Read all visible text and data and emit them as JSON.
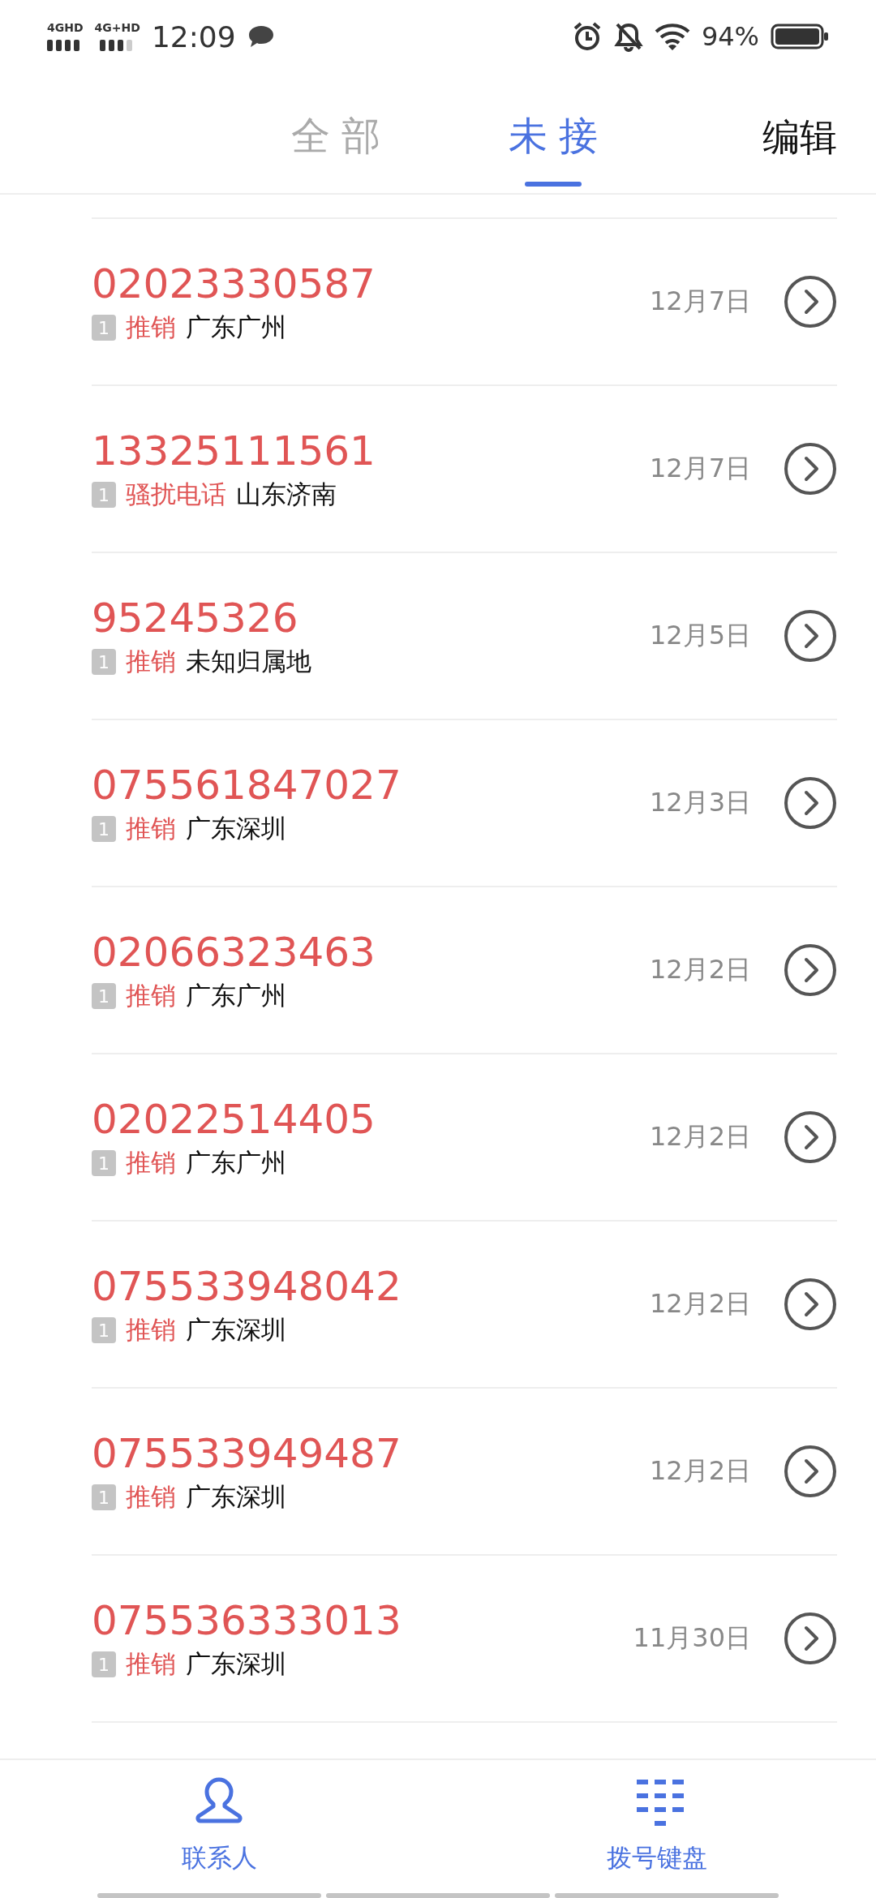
{
  "status_bar": {
    "network_1": "4GHD",
    "network_2": "4G+HD",
    "time": "12:09",
    "battery": "94%"
  },
  "tabs": [
    {
      "label": "全部",
      "selected": false
    },
    {
      "label": "未接",
      "selected": true
    }
  ],
  "edit_button": "编辑",
  "calls": [
    {
      "number": "02023330587",
      "sim": "1",
      "tag": "推销",
      "location": "广东广州",
      "date": "12月7日"
    },
    {
      "number": "13325111561",
      "sim": "1",
      "tag": "骚扰电话",
      "location": "山东济南",
      "date": "12月7日"
    },
    {
      "number": "95245326",
      "sim": "1",
      "tag": "推销",
      "location": "未知归属地",
      "date": "12月5日"
    },
    {
      "number": "075561847027",
      "sim": "1",
      "tag": "推销",
      "location": "广东深圳",
      "date": "12月3日"
    },
    {
      "number": "02066323463",
      "sim": "1",
      "tag": "推销",
      "location": "广东广州",
      "date": "12月2日"
    },
    {
      "number": "02022514405",
      "sim": "1",
      "tag": "推销",
      "location": "广东广州",
      "date": "12月2日"
    },
    {
      "number": "075533948042",
      "sim": "1",
      "tag": "推销",
      "location": "广东深圳",
      "date": "12月2日"
    },
    {
      "number": "075533949487",
      "sim": "1",
      "tag": "推销",
      "location": "广东深圳",
      "date": "12月2日"
    },
    {
      "number": "075536333013",
      "sim": "1",
      "tag": "推销",
      "location": "广东深圳",
      "date": "11月30日"
    }
  ],
  "bottom_nav": [
    {
      "kind": "contacts",
      "label": "联系人"
    },
    {
      "kind": "dialpad",
      "label": "拨号键盘"
    }
  ]
}
